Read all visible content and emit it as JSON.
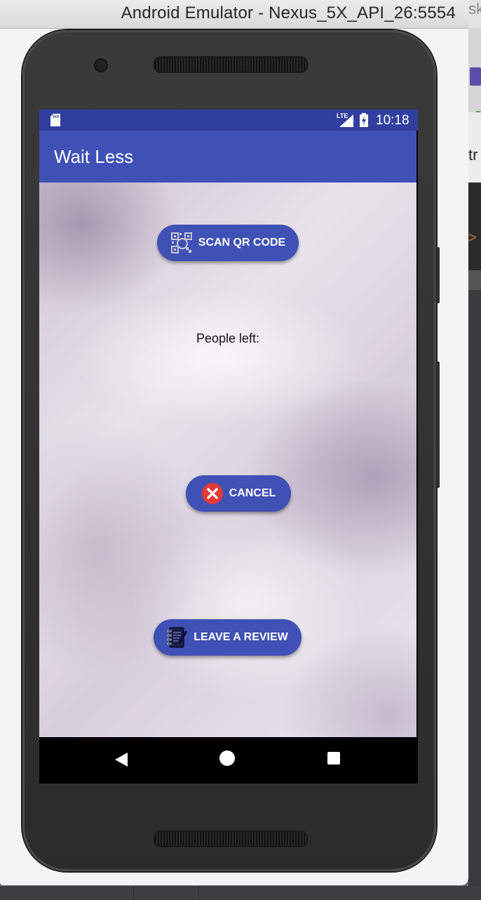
{
  "window": {
    "title": "Android Emulator - Nexus_5X_API_26:5554",
    "side_text_1": "sk",
    "side_text_2": "tr",
    "side_text_3": ">"
  },
  "status_bar": {
    "network_label": "LTE",
    "time": "10:18"
  },
  "app": {
    "title": "Wait Less",
    "scan_button_label": "SCAN QR CODE",
    "people_left_label": "People left:",
    "cancel_button_label": "CANCEL",
    "review_button_label": "LEAVE A REVIEW"
  },
  "icons": {
    "scan": "qr-code-icon",
    "cancel": "cancel-x-icon",
    "review": "notebook-pen-icon",
    "nav_back": "back-triangle-icon",
    "nav_home": "home-circle-icon",
    "nav_recent": "recent-square-icon"
  },
  "colors": {
    "status_bar": "#303f9f",
    "app_bar": "#3f51b5",
    "button": "#3f51b5",
    "cancel_icon": "#e53935"
  }
}
